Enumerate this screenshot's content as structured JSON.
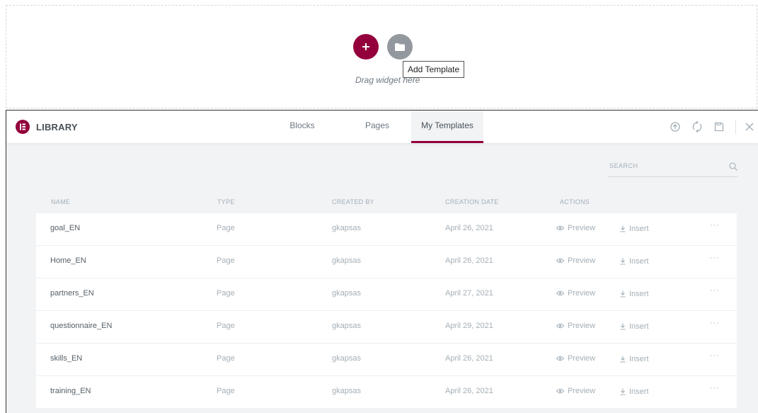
{
  "canvas": {
    "drag_text": "Drag widget here",
    "tooltip": "Add Template",
    "icons": {
      "add": "plus-icon",
      "template": "folder-icon"
    }
  },
  "library": {
    "title": "LIBRARY",
    "tabs": [
      {
        "label": "Blocks",
        "active": false
      },
      {
        "label": "Pages",
        "active": false
      },
      {
        "label": "My Templates",
        "active": true
      }
    ],
    "header_icons": [
      "upload-icon",
      "sync-icon",
      "save-icon",
      "close-icon"
    ],
    "search_placeholder": "SEARCH",
    "columns": {
      "name": "NAME",
      "type": "TYPE",
      "created_by": "CREATED BY",
      "creation_date": "CREATION DATE",
      "actions": "ACTIONS"
    },
    "actions": {
      "preview": "Preview",
      "insert": "Insert",
      "more": "···"
    },
    "templates": [
      {
        "name": "goal_EN",
        "type": "Page",
        "created_by": "gkapsas",
        "date": "April 26, 2021"
      },
      {
        "name": "Home_EN",
        "type": "Page",
        "created_by": "gkapsas",
        "date": "April 26, 2021"
      },
      {
        "name": "partners_EN",
        "type": "Page",
        "created_by": "gkapsas",
        "date": "April 27, 2021"
      },
      {
        "name": "questionnaire_EN",
        "type": "Page",
        "created_by": "gkapsas",
        "date": "April 29, 2021"
      },
      {
        "name": "skills_EN",
        "type": "Page",
        "created_by": "gkapsas",
        "date": "April 26, 2021"
      },
      {
        "name": "training_EN",
        "type": "Page",
        "created_by": "gkapsas",
        "date": "April 26, 2021"
      }
    ],
    "colors": {
      "accent": "#93003c",
      "muted": "#a4afb7"
    }
  }
}
